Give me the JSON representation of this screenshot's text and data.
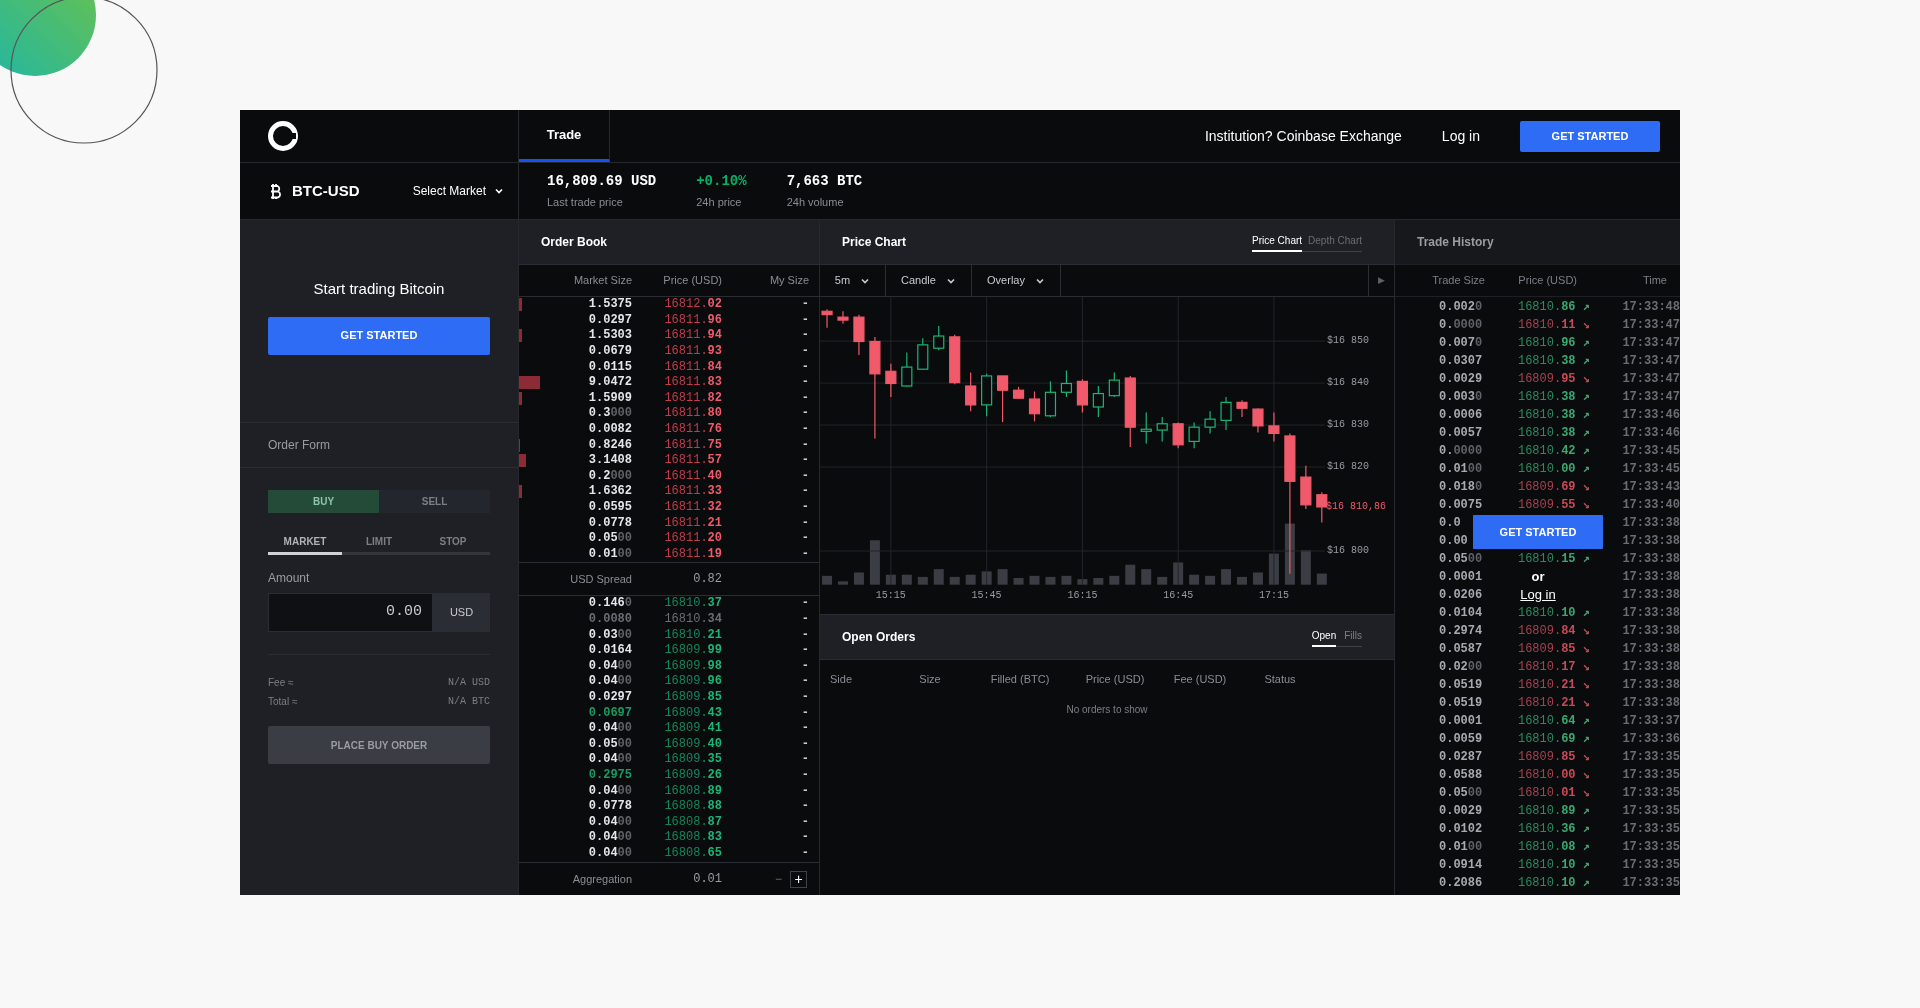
{
  "top_bar": {
    "tabs": [
      {
        "label": "Trade",
        "selected": true
      }
    ],
    "institution_link": "Institution? Coinbase Exchange",
    "login_link": "Log in",
    "get_started_button": "GET STARTED"
  },
  "ticker": {
    "pair": "BTC-USD",
    "market_select": "Select Market",
    "stats": [
      {
        "value": "16,809.69 USD",
        "label": "Last trade price",
        "kind": "plain"
      },
      {
        "value": "+0.10%",
        "label": "24h price",
        "kind": "change"
      },
      {
        "value": "7,663 BTC",
        "label": "24h volume",
        "kind": "plain"
      }
    ]
  },
  "promo": {
    "title": "Start trading Bitcoin",
    "button": "GET STARTED"
  },
  "order_form": {
    "title": "Order Form",
    "sides": [
      {
        "label": "BUY",
        "selected": true
      },
      {
        "label": "SELL",
        "selected": false
      }
    ],
    "types": [
      {
        "label": "MARKET",
        "selected": true
      },
      {
        "label": "LIMIT",
        "selected": false
      },
      {
        "label": "STOP",
        "selected": false
      }
    ],
    "amount_label": "Amount",
    "amount_value": "0.00",
    "amount_unit": "USD",
    "fees": [
      {
        "label": "Fee ≈",
        "value": "N/A USD"
      },
      {
        "label": "Total ≈",
        "value": "N/A BTC"
      }
    ],
    "submit_button": "PLACE BUY ORDER",
    "submit_disabled": true
  },
  "order_book": {
    "title": "Order Book",
    "columns": [
      "Market Size",
      "Price (USD)",
      "My Size"
    ],
    "asks": [
      {
        "size": "1.5375",
        "price": "16812.02",
        "my_size": "-",
        "kind": "normal"
      },
      {
        "size": "0.0297",
        "price": "16811.96",
        "my_size": "-",
        "kind": "normal"
      },
      {
        "size": "1.5303",
        "price": "16811.94",
        "my_size": "-",
        "kind": "normal"
      },
      {
        "size": "0.0679",
        "price": "16811.93",
        "my_size": "-",
        "kind": "normal"
      },
      {
        "size": "0.0115",
        "price": "16811.84",
        "my_size": "-",
        "kind": "normal"
      },
      {
        "size": "9.0472",
        "price": "16811.83",
        "my_size": "-",
        "kind": "normal"
      },
      {
        "size": "1.5909",
        "price": "16811.82",
        "my_size": "-",
        "kind": "normal"
      },
      {
        "size": "0.3",
        "faded": "000",
        "price": "16811.80",
        "my_size": "-",
        "kind": "normal"
      },
      {
        "size": "0.0082",
        "price": "16811.76",
        "my_size": "-",
        "kind": "normal"
      },
      {
        "size": "0.8246",
        "price": "16811.75",
        "my_size": "-",
        "kind": "normal"
      },
      {
        "size": "3.1408",
        "price": "16811.57",
        "my_size": "-",
        "kind": "normal"
      },
      {
        "size": "0.2",
        "faded": "000",
        "price": "16811.40",
        "my_size": "-",
        "kind": "normal"
      },
      {
        "size": "1.6362",
        "price": "16811.33",
        "my_size": "-",
        "kind": "normal"
      },
      {
        "size": "0.0595",
        "price": "16811.32",
        "my_size": "-",
        "kind": "normal"
      },
      {
        "size": "0.0778",
        "price": "16811.21",
        "my_size": "-",
        "kind": "normal"
      },
      {
        "size": "0.05",
        "faded": "00",
        "price": "16811.20",
        "my_size": "-",
        "kind": "normal"
      },
      {
        "size": "0.01",
        "faded": "00",
        "price": "16811.19",
        "my_size": "-",
        "kind": "normal"
      }
    ],
    "spread_label": "USD Spread",
    "spread_value": "0.82",
    "bids": [
      {
        "size": "0.146",
        "faded": "0",
        "price": "16810.37",
        "my_size": "-",
        "kind": "normal"
      },
      {
        "size": "0.0080",
        "price": "16810.34",
        "my_size": "-",
        "kind": "faded"
      },
      {
        "size": "0.03",
        "faded": "00",
        "price": "16810.21",
        "my_size": "-",
        "kind": "normal"
      },
      {
        "size": "0.0164",
        "price": "16809.99",
        "my_size": "-",
        "kind": "normal"
      },
      {
        "size": "0.04",
        "faded": "00",
        "price": "16809.98",
        "my_size": "-",
        "kind": "normal"
      },
      {
        "size": "0.04",
        "faded": "00",
        "price": "16809.96",
        "my_size": "-",
        "kind": "normal"
      },
      {
        "size": "0.0297",
        "price": "16809.85",
        "my_size": "-",
        "kind": "normal"
      },
      {
        "size": "0.0697",
        "price": "16809.43",
        "my_size": "-",
        "kind": "highlight"
      },
      {
        "size": "0.04",
        "faded": "00",
        "price": "16809.41",
        "my_size": "-",
        "kind": "normal"
      },
      {
        "size": "0.05",
        "faded": "00",
        "price": "16809.40",
        "my_size": "-",
        "kind": "normal"
      },
      {
        "size": "0.04",
        "faded": "00",
        "price": "16809.35",
        "my_size": "-",
        "kind": "normal"
      },
      {
        "size": "0.2975",
        "price": "16809.26",
        "my_size": "-",
        "kind": "highlight"
      },
      {
        "size": "0.04",
        "faded": "00",
        "price": "16808.89",
        "my_size": "-",
        "kind": "normal"
      },
      {
        "size": "0.0778",
        "price": "16808.88",
        "my_size": "-",
        "kind": "normal"
      },
      {
        "size": "0.04",
        "faded": "00",
        "price": "16808.87",
        "my_size": "-",
        "kind": "normal"
      },
      {
        "size": "0.04",
        "faded": "00",
        "price": "16808.83",
        "my_size": "-",
        "kind": "normal"
      },
      {
        "size": "0.04",
        "faded": "00",
        "price": "16808.65",
        "my_size": "-",
        "kind": "normal"
      }
    ],
    "aggregation_label": "Aggregation",
    "aggregation_value": "0.01",
    "minus_button": "−",
    "plus_button": "+"
  },
  "price_chart": {
    "title": "Price Chart",
    "tabs": [
      {
        "label": "Price Chart",
        "selected": true
      },
      {
        "label": "Depth Chart",
        "selected": false
      }
    ],
    "toolbar": [
      "5m",
      "Candle",
      "Overlay"
    ],
    "play_button": "▶",
    "chart_data": {
      "type": "candlestick",
      "x": [
        895,
        900,
        905,
        910,
        915,
        920,
        925,
        930,
        935,
        940,
        945,
        950,
        955,
        960,
        965,
        970,
        975,
        980,
        985,
        990,
        995,
        1000,
        1005,
        1010,
        1015,
        1020,
        1025,
        1030,
        1035,
        1040,
        1045,
        1050
      ],
      "xlim": [
        892.8,
        1051
      ],
      "ylim": [
        16791.9,
        16860.5
      ],
      "grid": true,
      "ohlc": [
        [
          16857.1,
          16857.6,
          16853.2,
          16856.3
        ],
        [
          16855.7,
          16857.1,
          16854.1,
          16855.0
        ],
        [
          16855.7,
          16856.3,
          16846.7,
          16849.9
        ],
        [
          16849.9,
          16851.0,
          16826.8,
          16842.2
        ],
        [
          16842.8,
          16844.6,
          16836.7,
          16839.9
        ],
        [
          16839.3,
          16847.3,
          16839.1,
          16843.8
        ],
        [
          16843.3,
          16850.7,
          16843.3,
          16849.1
        ],
        [
          16848.3,
          16853.6,
          16847.8,
          16851.2
        ],
        [
          16851.0,
          16851.5,
          16839.7,
          16840.1
        ],
        [
          16839.3,
          16842.5,
          16833.3,
          16834.8
        ],
        [
          16834.8,
          16842.2,
          16832.1,
          16841.7
        ],
        [
          16841.7,
          16841.7,
          16830.7,
          16838.3
        ],
        [
          16838.3,
          16839.1,
          16836.2,
          16836.4
        ],
        [
          16836.2,
          16838.0,
          16830.9,
          16832.7
        ],
        [
          16832.2,
          16840.4,
          16831.9,
          16837.8
        ],
        [
          16837.8,
          16843.0,
          16836.7,
          16839.9
        ],
        [
          16840.4,
          16840.9,
          16833.0,
          16834.8
        ],
        [
          16834.3,
          16839.3,
          16831.9,
          16837.5
        ],
        [
          16837.0,
          16842.5,
          16836.7,
          16840.7
        ],
        [
          16841.2,
          16841.7,
          16824.8,
          16829.5
        ],
        [
          16828.5,
          16833.0,
          16825.6,
          16829.0
        ],
        [
          16828.8,
          16831.9,
          16826.1,
          16830.3
        ],
        [
          16830.3,
          16830.6,
          16824.5,
          16825.3
        ],
        [
          16826.1,
          16830.6,
          16824.5,
          16829.5
        ],
        [
          16829.5,
          16833.3,
          16828.0,
          16831.4
        ],
        [
          16831.1,
          16836.7,
          16828.8,
          16835.4
        ],
        [
          16835.4,
          16835.9,
          16831.9,
          16834.0
        ],
        [
          16833.8,
          16834.0,
          16828.2,
          16829.8
        ],
        [
          16829.8,
          16833.0,
          16826.1,
          16828.0
        ],
        [
          16827.4,
          16828.0,
          16794.6,
          16816.6
        ],
        [
          16817.6,
          16820.3,
          16810.0,
          16811.0
        ],
        [
          16813.4,
          16814.0,
          16806.8,
          16810.5
        ]
      ],
      "yticks": [
        {
          "value": 16850,
          "label": "$16 850"
        },
        {
          "value": 16840,
          "label": "$16 840"
        },
        {
          "value": 16830,
          "label": "$16 830"
        },
        {
          "value": 16820,
          "label": "$16 820"
        },
        {
          "value": 16800,
          "label": "$16 800"
        }
      ],
      "xticks": [
        {
          "value": 915,
          "label": "15:15"
        },
        {
          "value": 945,
          "label": "15:45"
        },
        {
          "value": 975,
          "label": "16:15"
        },
        {
          "value": 1005,
          "label": "16:45"
        },
        {
          "value": 1035,
          "label": "17:15"
        }
      ]
    },
    "current_price_label": "$16 810,86"
  },
  "open_orders": {
    "title": "Open Orders",
    "tabs": [
      {
        "label": "Open",
        "selected": true
      },
      {
        "label": "Fills",
        "selected": false
      }
    ],
    "columns": [
      "Side",
      "Size",
      "Filled (BTC)",
      "Price (USD)",
      "Fee (USD)",
      "Status"
    ],
    "empty_message": "No orders to show"
  },
  "trade_history": {
    "title": "Trade History",
    "columns": [
      "Trade Size",
      "Price (USD)",
      "Time"
    ],
    "rows": [
      {
        "size": "0.002",
        "faded": "0",
        "price": "16810.86",
        "arrow": "↗",
        "rising": true,
        "time": "17:33:48"
      },
      {
        "size": "0.",
        "faded": "0000",
        "price": "16810.11",
        "arrow": "↘",
        "rising": false,
        "time": "17:33:47"
      },
      {
        "size": "0.007",
        "faded": "0",
        "price": "16810.96",
        "arrow": "↗",
        "rising": true,
        "time": "17:33:47"
      },
      {
        "size": "0.0307",
        "price": "16810.38",
        "arrow": "↗",
        "rising": true,
        "time": "17:33:47"
      },
      {
        "size": "0.0029",
        "price": "16809.95",
        "arrow": "↘",
        "rising": false,
        "time": "17:33:47"
      },
      {
        "size": "0.003",
        "faded": "0",
        "price": "16810.38",
        "arrow": "↗",
        "rising": true,
        "time": "17:33:47"
      },
      {
        "size": "0.0006",
        "price": "16810.38",
        "arrow": "↗",
        "rising": true,
        "time": "17:33:46"
      },
      {
        "size": "0.0057",
        "price": "16810.38",
        "arrow": "↗",
        "rising": true,
        "time": "17:33:46"
      },
      {
        "size": "0.",
        "faded": "0000",
        "price": "16810.42",
        "arrow": "↗",
        "rising": true,
        "time": "17:33:45"
      },
      {
        "size": "0.01",
        "faded": "00",
        "price": "16810.00",
        "arrow": "↗",
        "rising": true,
        "time": "17:33:45"
      },
      {
        "size": "0.018",
        "faded": "0",
        "price": "16809.69",
        "arrow": "↘",
        "rising": false,
        "time": "17:33:43"
      },
      {
        "size": "0.0075",
        "price": "16809.55",
        "arrow": "↘",
        "rising": false,
        "time": "17:33:40"
      },
      {
        "size": "0.0",
        "time": "17:33:38"
      },
      {
        "size": "0.00",
        "time": "17:33:38"
      },
      {
        "size": "0.05",
        "faded": "00",
        "price": "16810.15",
        "arrow": "↗",
        "rising": true,
        "time": "17:33:38"
      },
      {
        "size": "0.0001",
        "time": "17:33:38"
      },
      {
        "size": "0.0206",
        "time": "17:33:38"
      },
      {
        "size": "0.0104",
        "price": "16810.10",
        "arrow": "↗",
        "rising": true,
        "time": "17:33:38"
      },
      {
        "size": "0.2974",
        "price": "16809.84",
        "arrow": "↘",
        "rising": false,
        "time": "17:33:38"
      },
      {
        "size": "0.0587",
        "price": "16809.85",
        "arrow": "↘",
        "rising": false,
        "time": "17:33:38"
      },
      {
        "size": "0.02",
        "faded": "00",
        "price": "16810.17",
        "arrow": "↘",
        "rising": false,
        "time": "17:33:38"
      },
      {
        "size": "0.0519",
        "price": "16810.21",
        "arrow": "↘",
        "rising": false,
        "time": "17:33:38"
      },
      {
        "size": "0.0519",
        "price": "16810.21",
        "arrow": "↘",
        "rising": false,
        "time": "17:33:38"
      },
      {
        "size": "0.0001",
        "price": "16810.64",
        "arrow": "↗",
        "rising": true,
        "time": "17:33:37"
      },
      {
        "size": "0.0059",
        "price": "16810.69",
        "arrow": "↗",
        "rising": true,
        "time": "17:33:36"
      },
      {
        "size": "0.0287",
        "price": "16809.85",
        "arrow": "↘",
        "rising": false,
        "time": "17:33:35"
      },
      {
        "size": "0.0588",
        "price": "16810.00",
        "arrow": "↘",
        "rising": false,
        "time": "17:33:35"
      },
      {
        "size": "0.05",
        "faded": "00",
        "price": "16810.01",
        "arrow": "↘",
        "rising": false,
        "time": "17:33:35"
      },
      {
        "size": "0.0029",
        "price": "16810.89",
        "arrow": "↗",
        "rising": true,
        "time": "17:33:35"
      },
      {
        "size": "0.0102",
        "price": "16810.36",
        "arrow": "↗",
        "rising": true,
        "time": "17:33:35"
      },
      {
        "size": "0.01",
        "faded": "00",
        "price": "16810.08",
        "arrow": "↗",
        "rising": true,
        "time": "17:33:35"
      },
      {
        "size": "0.0914",
        "price": "16810.10",
        "arrow": "↗",
        "rising": true,
        "time": "17:33:35"
      },
      {
        "size": "0.2086",
        "price": "16810.10",
        "arrow": "↗",
        "rising": true,
        "time": "17:33:35"
      }
    ],
    "overlay": {
      "button": "GET STARTED",
      "separator": "or",
      "link": "Log in"
    }
  }
}
